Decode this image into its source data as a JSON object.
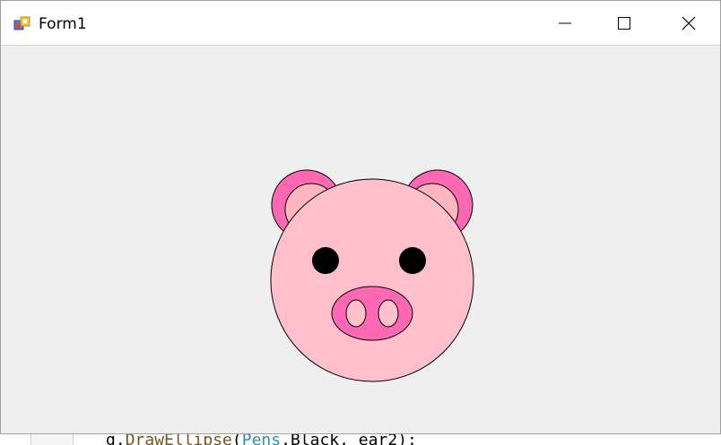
{
  "window": {
    "title": "Form1",
    "icon": "winforms-app-icon",
    "controls": {
      "minimize": "minimize-icon",
      "maximize": "maximize-icon",
      "close": "close-icon"
    }
  },
  "drawing": {
    "subject": "pig-face",
    "colors": {
      "face": "#ffc0cb",
      "ear_outer": "#ff69b4",
      "ear_inner": "#ffb6c1",
      "snout": "#ff69b4",
      "nostril": "#ffc0cb",
      "eye": "#000000",
      "outline": "#000000",
      "background": "#efefef"
    }
  },
  "background_editor": {
    "code_prefix": "g.",
    "code_method": "DrawEllipse",
    "code_open": "(",
    "code_type": "Pens",
    "code_rest": ".Black, ear2);"
  }
}
